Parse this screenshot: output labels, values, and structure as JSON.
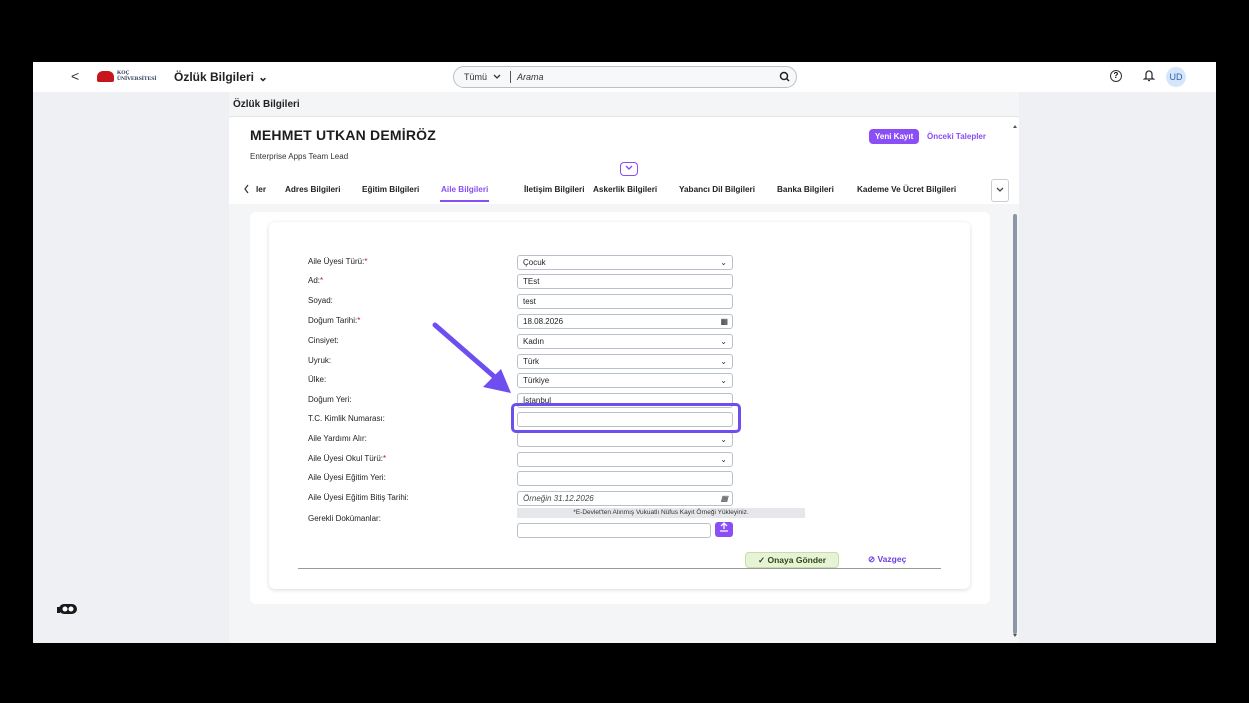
{
  "shellbar": {
    "back": "<",
    "logo_line1": "KOÇ",
    "logo_line2": "ÜNİVERSİTESİ",
    "app_title": "Özlük Bilgileri",
    "app_chevron": "⌄",
    "search_scope": "Tümü",
    "search_placeholder": "Arama",
    "help": "?",
    "avatar": "UD"
  },
  "page": {
    "title": "Özlük Bilgileri",
    "person_name": "MEHMET UTKAN DEMİRÖZ",
    "person_role": "Enterprise Apps Team Lead",
    "new_record": "Yeni Kayıt",
    "previous_requests": "Önceki Talepler",
    "tabs": [
      {
        "label": "ler"
      },
      {
        "label": "Adres Bilgileri"
      },
      {
        "label": "Eğitim Bilgileri"
      },
      {
        "label": "Aile Bilgileri"
      },
      {
        "label": "İletişim Bilgileri"
      },
      {
        "label": "Askerlik Bilgileri"
      },
      {
        "label": "Yabancı Dil Bilgileri"
      },
      {
        "label": "Banka Bilgileri"
      },
      {
        "label": "Kademe Ve Ücret Bilgileri"
      }
    ],
    "active_tab": "Aile Bilgileri"
  },
  "form": {
    "labels": {
      "member_type": "Aile Üyesi Türü:",
      "name": "Ad:",
      "surname": "Soyad:",
      "birth_date": "Doğum Tarihi:",
      "gender": "Cinsiyet:",
      "nationality": "Uyruk:",
      "country": "Ülke:",
      "birth_place": "Doğum Yeri:",
      "tc_no": "T.C. Kimlik Numarası:",
      "family_aid": "Aile Yardımı Alır:",
      "school_type": "Aile Üyesi Okul Türü:",
      "school_place": "Aile Üyesi Eğitim Yeri:",
      "edu_end_date": "Aile Üyesi Eğitim Bitiş Tarihi:",
      "documents": "Gerekli Dokümanlar:"
    },
    "required_mark": "*",
    "values": {
      "member_type": "Çocuk",
      "name": "TEst",
      "surname": "test",
      "birth_date": "18.08.2026",
      "gender": "Kadın",
      "nationality": "Türk",
      "country": "Türkiye",
      "birth_place": "İstanbul",
      "tc_no": "",
      "family_aid": "",
      "school_type": "",
      "school_place": ""
    },
    "edu_end_date_placeholder": "Örneğin 31.12.2026",
    "document_note": "*E-Devlet'ten Alınmış Vukuatlı Nüfus Kayıt Örneği Yükleyiniz.",
    "submit": "Onaya Gönder",
    "cancel": "Vazgeç"
  },
  "colors": {
    "accent": "#8a4df6",
    "arrow": "#6f4ef0",
    "required": "#c4161c",
    "submit_bg": "#e7f2d6"
  }
}
